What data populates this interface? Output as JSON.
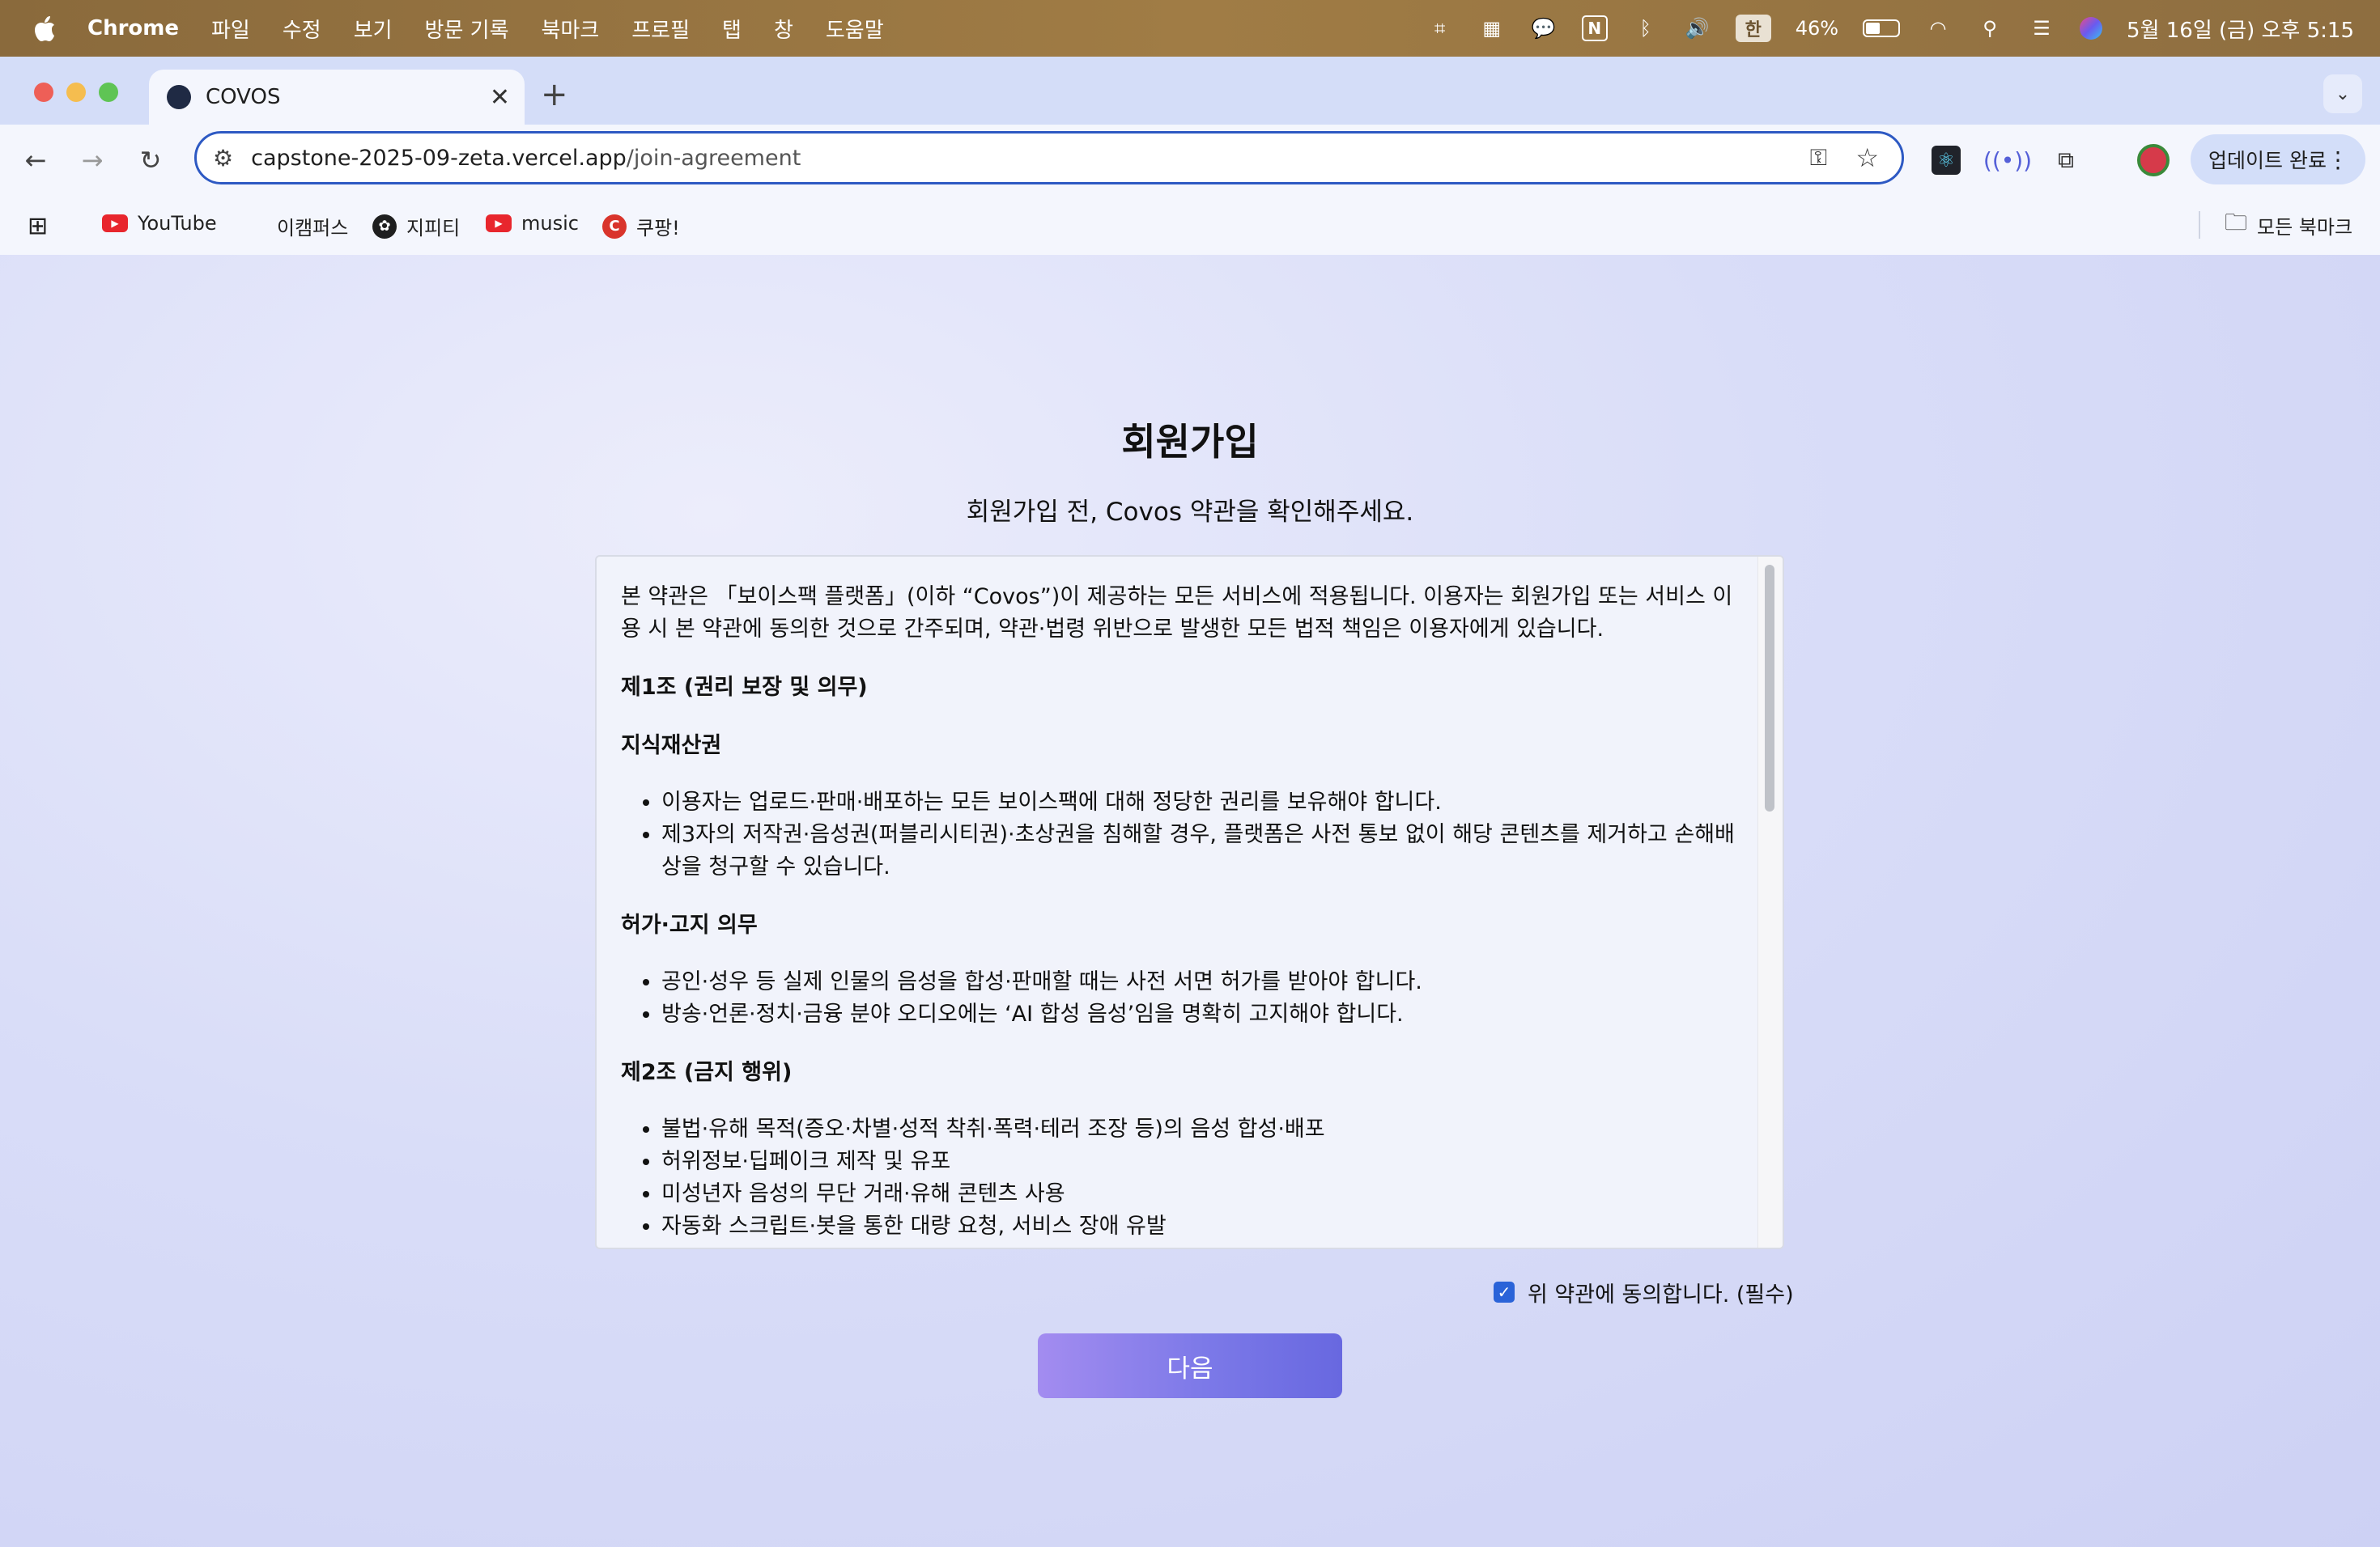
{
  "menubar": {
    "app_name": "Chrome",
    "menus": [
      "파일",
      "수정",
      "보기",
      "방문 기록",
      "북마크",
      "프로필",
      "탭",
      "창",
      "도움말"
    ],
    "input_method": "한",
    "battery_percent": "46%",
    "battery_level": 0.46,
    "datetime": "5월 16일 (금) 오후 5:15"
  },
  "browser": {
    "tab_title": "COVOS",
    "url_host": "capstone-2025-09-zeta.vercel.app",
    "url_path": "/join-agreement",
    "update_label": "업데이트 완료",
    "bookmarks": [
      "YouTube",
      "이캠퍼스",
      "지피티",
      "music",
      "쿠팡!"
    ],
    "all_bookmarks_label": "모든 북마크"
  },
  "page": {
    "title": "회원가입",
    "subtitle": "회원가입 전, Covos 약관을 확인해주세요.",
    "terms": {
      "intro": "본 약관은 「보이스팩 플랫폼」(이하 “Covos”)이 제공하는 모든 서비스에 적용됩니다. 이용자는 회원가입 또는 서비스 이용 시 본 약관에 동의한 것으로 간주되며, 약관·법령 위반으로 발생한 모든 법적 책임은 이용자에게 있습니다.",
      "article1_title": "제1조 (권리 보장 및 의무)",
      "ip_title": "지식재산권",
      "ip_items": [
        "이용자는 업로드·판매·배포하는 모든 보이스팩에 대해 정당한 권리를 보유해야 합니다.",
        "제3자의 저작권·음성권(퍼블리시티권)·초상권을 침해할 경우, 플랫폼은 사전 통보 없이 해당 콘텐츠를 제거하고 손해배상을 청구할 수 있습니다."
      ],
      "permission_title": "허가·고지 의무",
      "permission_items": [
        "공인·성우 등 실제 인물의 음성을 합성·판매할 때는 사전 서면 허가를 받아야 합니다.",
        "방송·언론·정치·금융 분야 오디오에는 ‘AI 합성 음성’임을 명확히 고지해야 합니다."
      ],
      "article2_title": "제2조 (금지 행위)",
      "prohibited_items": [
        "불법·유해 목적(증오·차별·성적 착취·폭력·테러 조장 등)의 음성 합성·배포",
        "허위정보·딥페이크 제작 및 유포",
        "미성년자 음성의 무단 거래·유해 콘텐츠 사용",
        "자동화 스크립트·봇을 통한 대량 요청, 서비스 장애 유발"
      ]
    },
    "agree_label": "위 약관에 동의합니다. (필수)",
    "agree_checked": true,
    "next_label": "다음"
  }
}
